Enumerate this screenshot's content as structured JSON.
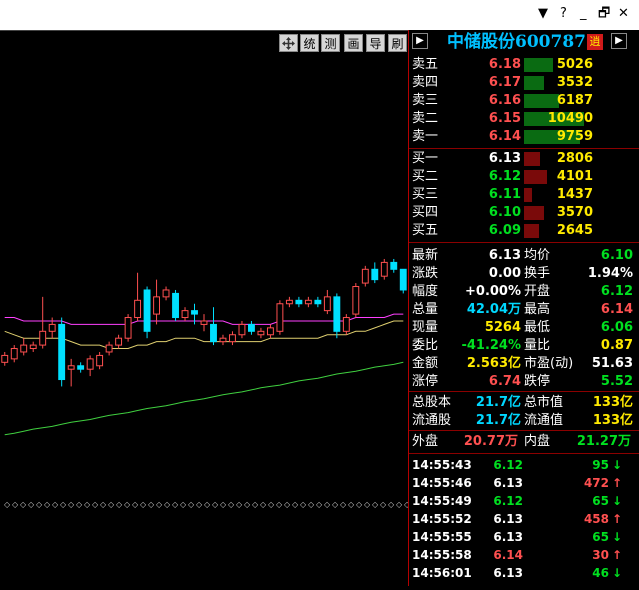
{
  "window_controls": [
    "▼",
    "?",
    "_",
    "🗗",
    "✕"
  ],
  "toolbar": {
    "buttons": [
      "统",
      "测",
      "画",
      "导",
      "刷"
    ]
  },
  "panel": {
    "title_name": "中储股份",
    "title_code": "600787",
    "badge": "逍",
    "sell": [
      {
        "label": "卖五",
        "price": "6.18",
        "vol": "5026",
        "fill": 0.48
      },
      {
        "label": "卖四",
        "price": "6.17",
        "vol": "3532",
        "fill": 0.34
      },
      {
        "label": "卖三",
        "price": "6.16",
        "vol": "6187",
        "fill": 0.59
      },
      {
        "label": "卖二",
        "price": "6.15",
        "vol": "10490",
        "fill": 1.0
      },
      {
        "label": "卖一",
        "price": "6.14",
        "vol": "9759",
        "fill": 0.93
      }
    ],
    "buy": [
      {
        "label": "买一",
        "price": "6.13",
        "vol": "2806",
        "fill": 0.27
      },
      {
        "label": "买二",
        "price": "6.12",
        "vol": "4101",
        "fill": 0.39
      },
      {
        "label": "买三",
        "price": "6.11",
        "vol": "1437",
        "fill": 0.14
      },
      {
        "label": "买四",
        "price": "6.10",
        "vol": "3570",
        "fill": 0.34
      },
      {
        "label": "买五",
        "price": "6.09",
        "vol": "2645",
        "fill": 0.25
      }
    ],
    "stats": [
      {
        "l1": "最新",
        "v1": "6.13",
        "c1": "white",
        "l2": "均价",
        "v2": "6.10",
        "c2": "green"
      },
      {
        "l1": "涨跌",
        "v1": "0.00",
        "c1": "white",
        "l2": "换手",
        "v2": "1.94%",
        "c2": "white"
      },
      {
        "l1": "幅度",
        "v1": "+0.00%",
        "c1": "white",
        "l2": "开盘",
        "v2": "6.12",
        "c2": "green"
      },
      {
        "l1": "总量",
        "v1": "42.04万",
        "c1": "cyan",
        "l2": "最高",
        "v2": "6.14",
        "c2": "red"
      },
      {
        "l1": "现量",
        "v1": "5264",
        "c1": "yellow",
        "l2": "最低",
        "v2": "6.06",
        "c2": "green"
      },
      {
        "l1": "委比",
        "v1": "-41.24%",
        "c1": "green",
        "l2": "量比",
        "v2": "0.87",
        "c2": "yellow"
      },
      {
        "l1": "金额",
        "v1": "2.563亿",
        "c1": "yellow",
        "l2": "市盈(动)",
        "v2": "51.63",
        "c2": "white"
      },
      {
        "l1": "涨停",
        "v1": "6.74",
        "c1": "red",
        "l2": "跌停",
        "v2": "5.52",
        "c2": "green"
      }
    ],
    "capital": [
      {
        "l1": "总股本",
        "v1": "21.7亿",
        "l2": "总市值",
        "v2": "133亿"
      },
      {
        "l1": "流通股",
        "v1": "21.7亿",
        "l2": "流通值",
        "v2": "133亿"
      }
    ],
    "outer_label": "外盘",
    "outer_value": "20.77万",
    "inner_label": "内盘",
    "inner_value": "21.27万",
    "ticks": [
      {
        "time": "14:55:43",
        "price": "6.12",
        "pc": "green",
        "vol": "95",
        "dir": "↓",
        "dc": "green"
      },
      {
        "time": "14:55:46",
        "price": "6.13",
        "pc": "white",
        "vol": "472",
        "dir": "↑",
        "dc": "red"
      },
      {
        "time": "14:55:49",
        "price": "6.12",
        "pc": "green",
        "vol": "65",
        "dir": "↓",
        "dc": "green"
      },
      {
        "time": "14:55:52",
        "price": "6.13",
        "pc": "white",
        "vol": "458",
        "dir": "↑",
        "dc": "red"
      },
      {
        "time": "14:55:55",
        "price": "6.13",
        "pc": "white",
        "vol": "65",
        "dir": "↓",
        "dc": "green"
      },
      {
        "time": "14:55:58",
        "price": "6.14",
        "pc": "red",
        "vol": "30",
        "dir": "↑",
        "dc": "red"
      },
      {
        "time": "14:56:01",
        "price": "6.13",
        "pc": "white",
        "vol": "46",
        "dir": "↓",
        "dc": "green"
      }
    ]
  },
  "colors": {
    "up": "#ff5050",
    "down": "#00e0ff",
    "ma_yellow": "#e0d070",
    "ma_magenta": "#ff40ff",
    "ma_green": "#40d040",
    "ask_bar": "#0a6b12",
    "bid_bar": "#7a0a0a"
  },
  "chart_data": {
    "type": "candlestick",
    "candles": [
      {
        "o": 5.965,
        "c": 5.975,
        "h": 5.98,
        "l": 5.96
      },
      {
        "o": 5.97,
        "c": 5.985,
        "h": 5.99,
        "l": 5.965
      },
      {
        "o": 5.98,
        "c": 5.99,
        "h": 6.0,
        "l": 5.975
      },
      {
        "o": 5.985,
        "c": 5.99,
        "h": 5.995,
        "l": 5.98
      },
      {
        "o": 5.99,
        "c": 6.01,
        "h": 6.06,
        "l": 5.985
      },
      {
        "o": 6.01,
        "c": 6.02,
        "h": 6.03,
        "l": 6.0
      },
      {
        "o": 6.02,
        "c": 5.94,
        "h": 6.03,
        "l": 5.93
      },
      {
        "o": 5.955,
        "c": 5.96,
        "h": 5.97,
        "l": 5.93
      },
      {
        "o": 5.96,
        "c": 5.955,
        "h": 5.965,
        "l": 5.95
      },
      {
        "o": 5.955,
        "c": 5.97,
        "h": 5.975,
        "l": 5.945
      },
      {
        "o": 5.96,
        "c": 5.975,
        "h": 5.98,
        "l": 5.955
      },
      {
        "o": 5.98,
        "c": 5.99,
        "h": 5.995,
        "l": 5.975
      },
      {
        "o": 5.99,
        "c": 6.0,
        "h": 6.005,
        "l": 5.985
      },
      {
        "o": 6.0,
        "c": 6.03,
        "h": 6.035,
        "l": 5.995
      },
      {
        "o": 6.03,
        "c": 6.055,
        "h": 6.095,
        "l": 6.025
      },
      {
        "o": 6.07,
        "c": 6.01,
        "h": 6.075,
        "l": 6.0
      },
      {
        "o": 6.035,
        "c": 6.06,
        "h": 6.085,
        "l": 6.02
      },
      {
        "o": 6.06,
        "c": 6.07,
        "h": 6.075,
        "l": 6.055
      },
      {
        "o": 6.065,
        "c": 6.03,
        "h": 6.07,
        "l": 6.025
      },
      {
        "o": 6.03,
        "c": 6.04,
        "h": 6.045,
        "l": 6.025
      },
      {
        "o": 6.04,
        "c": 6.035,
        "h": 6.05,
        "l": 6.02
      },
      {
        "o": 6.02,
        "c": 6.025,
        "h": 6.035,
        "l": 6.01
      },
      {
        "o": 6.02,
        "c": 5.995,
        "h": 6.045,
        "l": 5.99
      },
      {
        "o": 5.995,
        "c": 6.0,
        "h": 6.005,
        "l": 5.99
      },
      {
        "o": 5.995,
        "c": 6.005,
        "h": 6.01,
        "l": 5.99
      },
      {
        "o": 6.005,
        "c": 6.02,
        "h": 6.025,
        "l": 6.0
      },
      {
        "o": 6.02,
        "c": 6.01,
        "h": 6.025,
        "l": 6.005
      },
      {
        "o": 6.005,
        "c": 6.01,
        "h": 6.015,
        "l": 6.0
      },
      {
        "o": 6.005,
        "c": 6.015,
        "h": 6.02,
        "l": 6.0
      },
      {
        "o": 6.01,
        "c": 6.05,
        "h": 6.055,
        "l": 6.005
      },
      {
        "o": 6.05,
        "c": 6.055,
        "h": 6.06,
        "l": 6.045
      },
      {
        "o": 6.055,
        "c": 6.05,
        "h": 6.06,
        "l": 6.045
      },
      {
        "o": 6.05,
        "c": 6.055,
        "h": 6.06,
        "l": 6.045
      },
      {
        "o": 6.055,
        "c": 6.05,
        "h": 6.06,
        "l": 6.045
      },
      {
        "o": 6.04,
        "c": 6.06,
        "h": 6.07,
        "l": 6.035
      },
      {
        "o": 6.06,
        "c": 6.01,
        "h": 6.065,
        "l": 6.0
      },
      {
        "o": 6.01,
        "c": 6.03,
        "h": 6.035,
        "l": 6.005
      },
      {
        "o": 6.035,
        "c": 6.075,
        "h": 6.08,
        "l": 6.03
      },
      {
        "o": 6.08,
        "c": 6.1,
        "h": 6.105,
        "l": 6.075
      },
      {
        "o": 6.1,
        "c": 6.085,
        "h": 6.11,
        "l": 6.08
      },
      {
        "o": 6.09,
        "c": 6.11,
        "h": 6.115,
        "l": 6.085
      },
      {
        "o": 6.11,
        "c": 6.1,
        "h": 6.115,
        "l": 6.095
      },
      {
        "o": 6.1,
        "c": 6.07,
        "h": 6.1,
        "l": 6.065
      }
    ],
    "ma_yellow": [
      6.01,
      6.005,
      6.0,
      6.0,
      6.0,
      6.0,
      6.0,
      5.995,
      5.99,
      5.99,
      5.99,
      5.985,
      5.985,
      5.985,
      5.99,
      5.99,
      5.995,
      5.995,
      6.0,
      6.0,
      6.0,
      5.995,
      5.995,
      5.995,
      5.995,
      5.995,
      5.995,
      5.995,
      6.0,
      6.0,
      6.0,
      6.0,
      6.0,
      6.0,
      6.005,
      6.005,
      6.005,
      6.01,
      6.01,
      6.015,
      6.02,
      6.025,
      6.025
    ],
    "ma_magenta": [
      6.03,
      6.03,
      6.025,
      6.025,
      6.025,
      6.025,
      6.025,
      6.02,
      6.02,
      6.02,
      6.02,
      6.02,
      6.02,
      6.02,
      6.025,
      6.025,
      6.025,
      6.025,
      6.025,
      6.025,
      6.025,
      6.025,
      6.025,
      6.025,
      6.02,
      6.02,
      6.02,
      6.02,
      6.02,
      6.025,
      6.025,
      6.025,
      6.025,
      6.025,
      6.025,
      6.025,
      6.025,
      6.03,
      6.03,
      6.03,
      6.03,
      6.035,
      6.035
    ],
    "ma_green": [
      5.86,
      5.862,
      5.865,
      5.868,
      5.87,
      5.872,
      5.875,
      5.878,
      5.88,
      5.882,
      5.885,
      5.888,
      5.89,
      5.892,
      5.895,
      5.898,
      5.9,
      5.902,
      5.905,
      5.908,
      5.91,
      5.912,
      5.915,
      5.918,
      5.92,
      5.922,
      5.925,
      5.928,
      5.93,
      5.932,
      5.935,
      5.938,
      5.94,
      5.942,
      5.945,
      5.948,
      5.95,
      5.952,
      5.955,
      5.958,
      5.96,
      5.962,
      5.965
    ]
  }
}
